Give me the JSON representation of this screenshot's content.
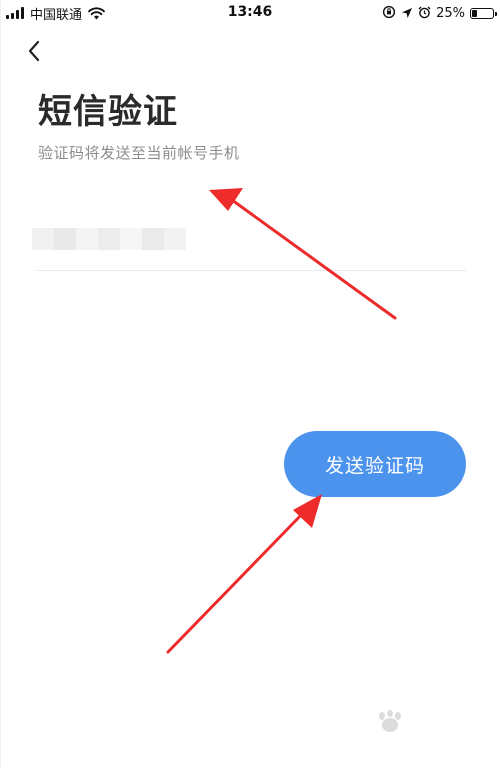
{
  "status_bar": {
    "carrier": "中国联通",
    "time": "13:46",
    "battery_percent": "25%",
    "battery_level": 0.25
  },
  "header": {
    "title": "短信验证",
    "subtitle": "验证码将发送至当前帐号手机"
  },
  "phone_field": {
    "value_obscured": true
  },
  "actions": {
    "send_code_label": "发送验证码"
  },
  "icons": {
    "back": "chevron-left-icon",
    "wifi": "wifi-icon",
    "signal": "signal-icon",
    "location": "location-arrow-icon",
    "alarm": "alarm-clock-icon",
    "lock_rotation": "rotation-lock-icon",
    "battery": "battery-icon"
  },
  "colors": {
    "primary_button": "#4b93ec",
    "annotation_arrow": "#ee2b2b",
    "title_text": "#2a2a2a",
    "subtitle_text": "#8c8c8c"
  }
}
